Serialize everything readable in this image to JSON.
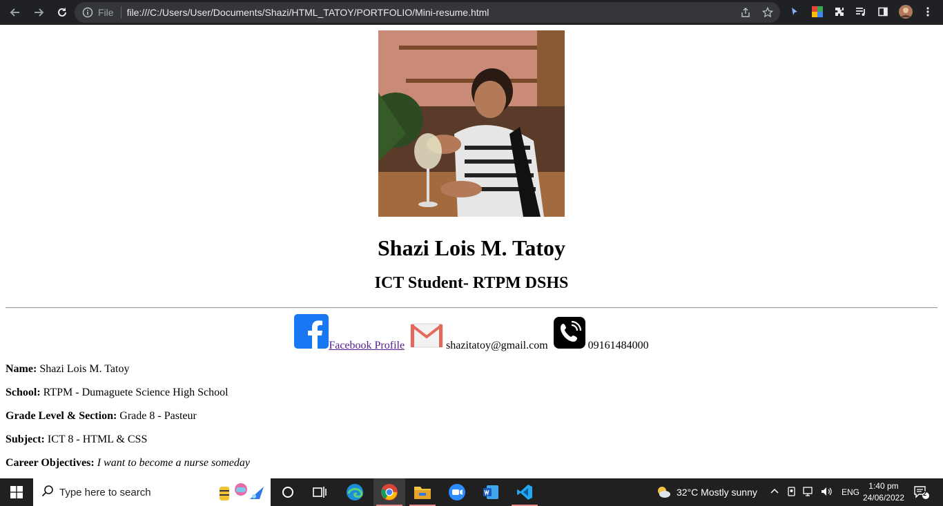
{
  "browser": {
    "info_label": "File",
    "url": "file:///C:/Users/User/Documents/Shazi/HTML_TATOY/PORTFOLIO/Mini-resume.html"
  },
  "profile": {
    "name": "Shazi Lois M. Tatoy",
    "role": "ICT Student- RTPM DSHS"
  },
  "contacts": {
    "facebook_label": "Facebook Profile",
    "email": "shazitatoy@gmail.com",
    "phone": "09161484000"
  },
  "details": [
    {
      "label": "Name:",
      "value": "Shazi Lois M. Tatoy"
    },
    {
      "label": "School:",
      "value": "RTPM - Dumaguete Science High School"
    },
    {
      "label": "Grade Level & Section:",
      "value": "Grade 8 - Pasteur"
    },
    {
      "label": "Subject:",
      "value": "ICT 8 - HTML & CSS"
    },
    {
      "label": "Career Objectives:",
      "value": "I want to become a nurse someday"
    }
  ],
  "taskbar": {
    "search_placeholder": "Type here to search",
    "weather": "32°C  Mostly sunny",
    "language": "ENG",
    "time": "1:40 pm",
    "date": "24/06/2022",
    "notification_count": "2"
  },
  "colors": {
    "chrome_bg": "#202124",
    "omnibox_bg": "#35363a",
    "facebook_blue": "#1877f2",
    "visited_link": "#551a8b",
    "taskbar_bg": "#202020"
  }
}
